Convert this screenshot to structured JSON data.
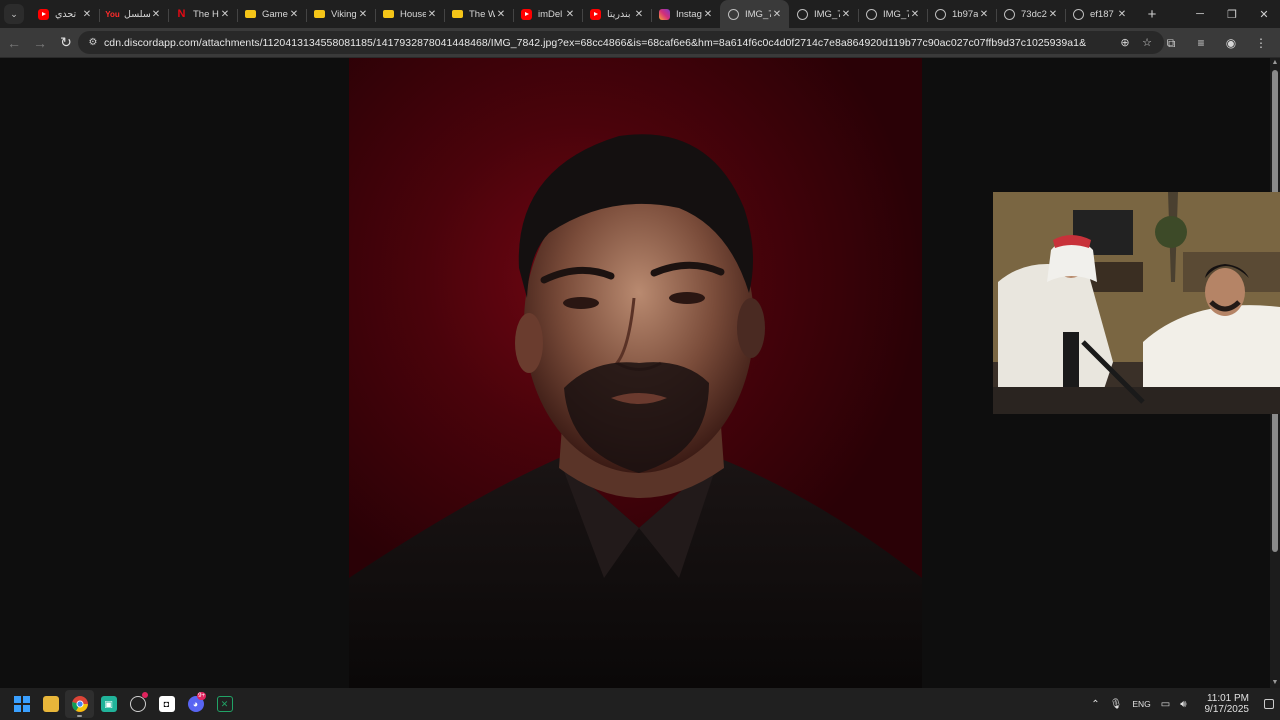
{
  "tabs": [
    {
      "title": "تحدي",
      "icon": "youtube-icon",
      "fav": "fav-yt"
    },
    {
      "title": "مسلسل",
      "icon": "youtube-old-icon",
      "fav": "fav-youtube-old"
    },
    {
      "title": "The H",
      "icon": "netflix-icon",
      "fav": "fav-netflix"
    },
    {
      "title": "Game",
      "icon": "imdb-icon",
      "fav": "fav-imdb"
    },
    {
      "title": "Viking",
      "icon": "imdb-icon",
      "fav": "fav-imdb"
    },
    {
      "title": "House",
      "icon": "imdb-icon",
      "fav": "fav-imdb"
    },
    {
      "title": "The W",
      "icon": "imdb-icon",
      "fav": "fav-imdb"
    },
    {
      "title": "imDel",
      "icon": "youtube-icon",
      "fav": "fav-yt"
    },
    {
      "title": "بندريتا",
      "icon": "youtube-icon",
      "fav": "fav-yt"
    },
    {
      "title": "Instag",
      "icon": "instagram-icon",
      "fav": "fav-insta"
    },
    {
      "title": "IMG_7",
      "icon": "globe-icon",
      "fav": "fav-globe",
      "active": true
    },
    {
      "title": "IMG_7",
      "icon": "globe-icon",
      "fav": "fav-globe"
    },
    {
      "title": "IMG_7",
      "icon": "globe-icon",
      "fav": "fav-globe"
    },
    {
      "title": "1b97a",
      "icon": "globe-icon",
      "fav": "fav-globe"
    },
    {
      "title": "73dc2",
      "icon": "globe-icon",
      "fav": "fav-globe"
    },
    {
      "title": "ef187",
      "icon": "globe-icon",
      "fav": "fav-globe"
    }
  ],
  "toolbar": {
    "url": "cdn.discordapp.com/attachments/1120413134558081185/1417932878041448468/IMG_7842.jpg?ex=68cc4866&is=68caf6e6&hm=8a614f6c0c4d0f2714c7e8a864920d119b77c90ac027c07ffb9d37c1025939a1&"
  },
  "taskbar": {
    "language": "ENG",
    "time": "11:01 PM",
    "date": "9/17/2025",
    "discord_badge": "9+"
  },
  "colors": {
    "photo_background": "#5a0410",
    "chrome_frame": "#1f1f1f",
    "toolbar": "#3a3a3a"
  }
}
